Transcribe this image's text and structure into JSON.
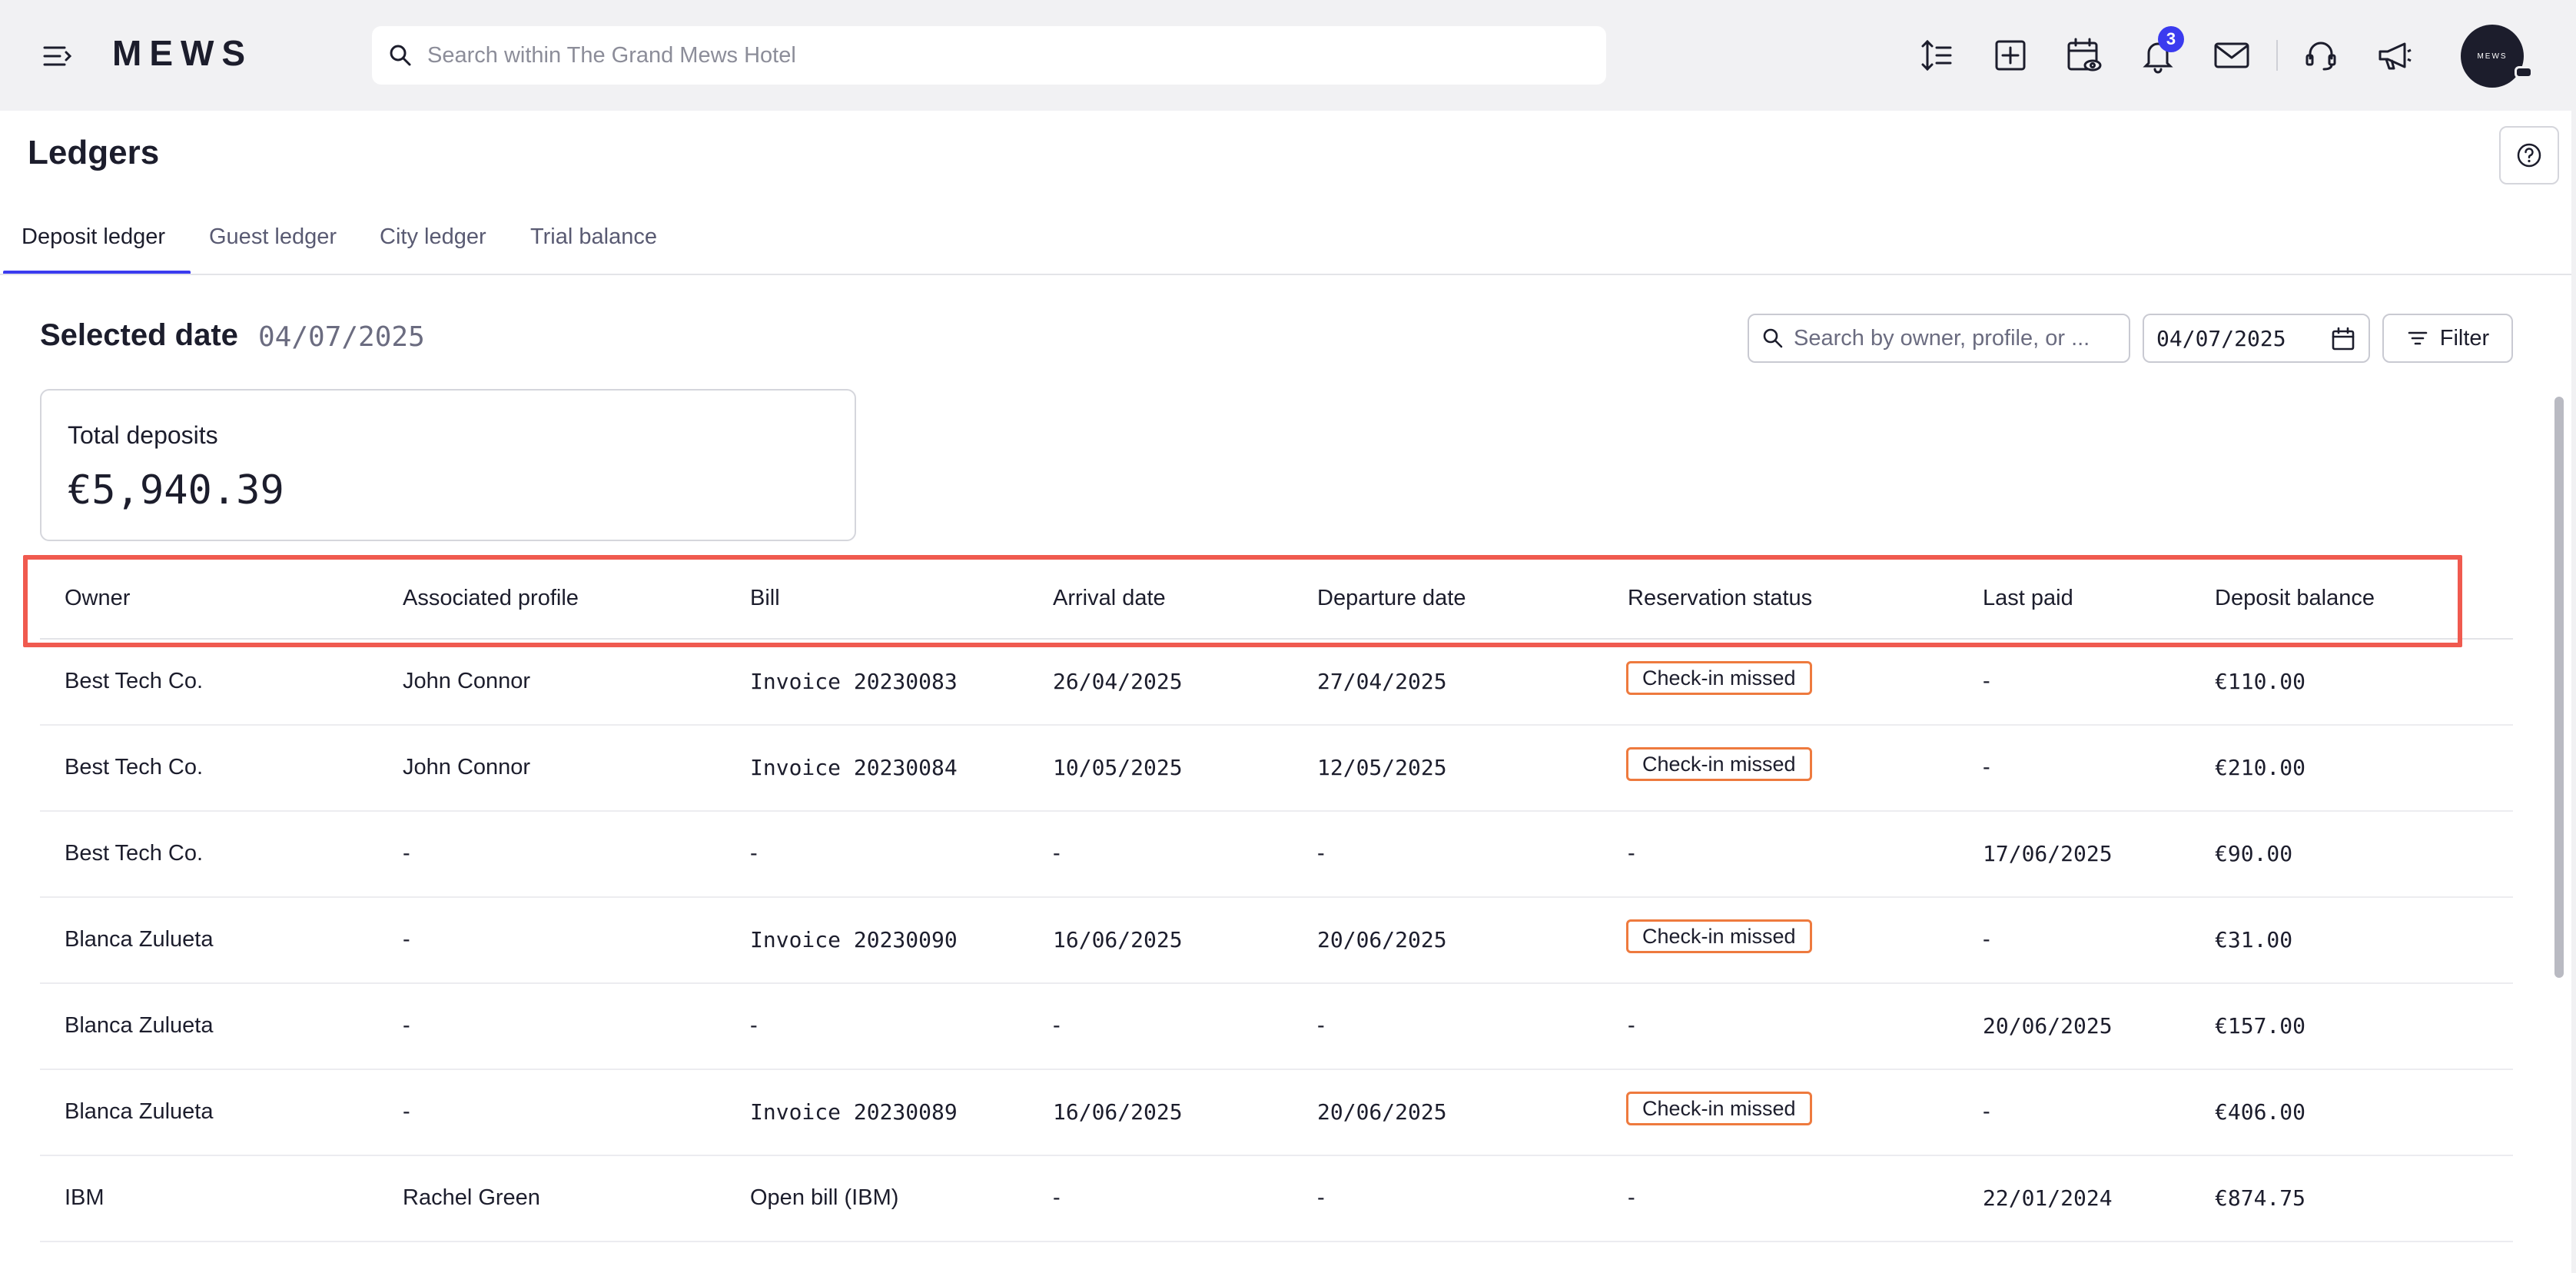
{
  "app": {
    "logo": "MEWS",
    "search_placeholder": "Search within The Grand Mews Hotel",
    "notification_count": "3",
    "avatar_text": "MEWS"
  },
  "toolbar_icons": [
    "sort-lines-icon",
    "add-square-icon",
    "calendar-eye-icon",
    "bell-icon",
    "mail-icon",
    "headset-icon",
    "megaphone-icon"
  ],
  "page": {
    "title": "Ledgers",
    "tabs": [
      {
        "label": "Deposit ledger",
        "active": true
      },
      {
        "label": "Guest ledger",
        "active": false
      },
      {
        "label": "City ledger",
        "active": false
      },
      {
        "label": "Trial balance",
        "active": false
      }
    ],
    "selected_date_label": "Selected date",
    "selected_date_value": "04/07/2025",
    "search_placeholder": "Search by owner, profile, or ...",
    "date_value": "04/07/2025",
    "filter_label": "Filter",
    "total_deposits_label": "Total deposits",
    "total_deposits_value": "€5,940.39"
  },
  "table": {
    "columns": [
      "Owner",
      "Associated profile",
      "Bill",
      "Arrival date",
      "Departure date",
      "Reservation status",
      "Last paid",
      "Deposit balance"
    ],
    "rows": [
      [
        "Best Tech Co.",
        "John Connor",
        "Invoice 20230083",
        "26/04/2025",
        "27/04/2025",
        "Check-in missed",
        "-",
        "€110.00"
      ],
      [
        "Best Tech Co.",
        "John Connor",
        "Invoice 20230084",
        "10/05/2025",
        "12/05/2025",
        "Check-in missed",
        "-",
        "€210.00"
      ],
      [
        "Best Tech Co.",
        "-",
        "-",
        "-",
        "-",
        "-",
        "17/06/2025",
        "€90.00"
      ],
      [
        "Blanca Zulueta",
        "-",
        "Invoice 20230090",
        "16/06/2025",
        "20/06/2025",
        "Check-in missed",
        "-",
        "€31.00"
      ],
      [
        "Blanca Zulueta",
        "-",
        "-",
        "-",
        "-",
        "-",
        "20/06/2025",
        "€157.00"
      ],
      [
        "Blanca Zulueta",
        "-",
        "Invoice 20230089",
        "16/06/2025",
        "20/06/2025",
        "Check-in missed",
        "-",
        "€406.00"
      ],
      [
        "IBM",
        "Rachel Green",
        "Open bill (IBM)",
        "-",
        "-",
        "-",
        "22/01/2024",
        "€874.75"
      ]
    ]
  },
  "colors": {
    "accent": "#3b3bef",
    "status_border": "#ee7a3e",
    "highlight": "#f05a4f"
  }
}
